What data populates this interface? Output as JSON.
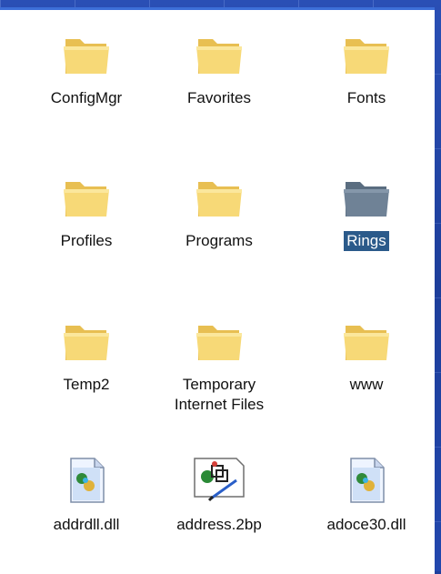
{
  "explorer": {
    "items": [
      {
        "label": "ConfigMgr",
        "type": "folder"
      },
      {
        "label": "Favorites",
        "type": "folder"
      },
      {
        "label": "Fonts",
        "type": "folder"
      },
      {
        "label": "Profiles",
        "type": "folder"
      },
      {
        "label": "Programs",
        "type": "folder"
      },
      {
        "label": "Rings",
        "type": "folder",
        "selected": true
      },
      {
        "label": "Temp2",
        "type": "folder"
      },
      {
        "label": "Temporary\nInternet Files",
        "type": "folder"
      },
      {
        "label": "www",
        "type": "folder"
      },
      {
        "label": "addrdll.dll",
        "type": "dll"
      },
      {
        "label": "address.2bp",
        "type": "2bp"
      },
      {
        "label": "adoce30.dll",
        "type": "dll"
      }
    ]
  },
  "colors": {
    "background": "#1f3f9c",
    "selection": "#2b5a8a",
    "folder": "#f5d36b"
  }
}
